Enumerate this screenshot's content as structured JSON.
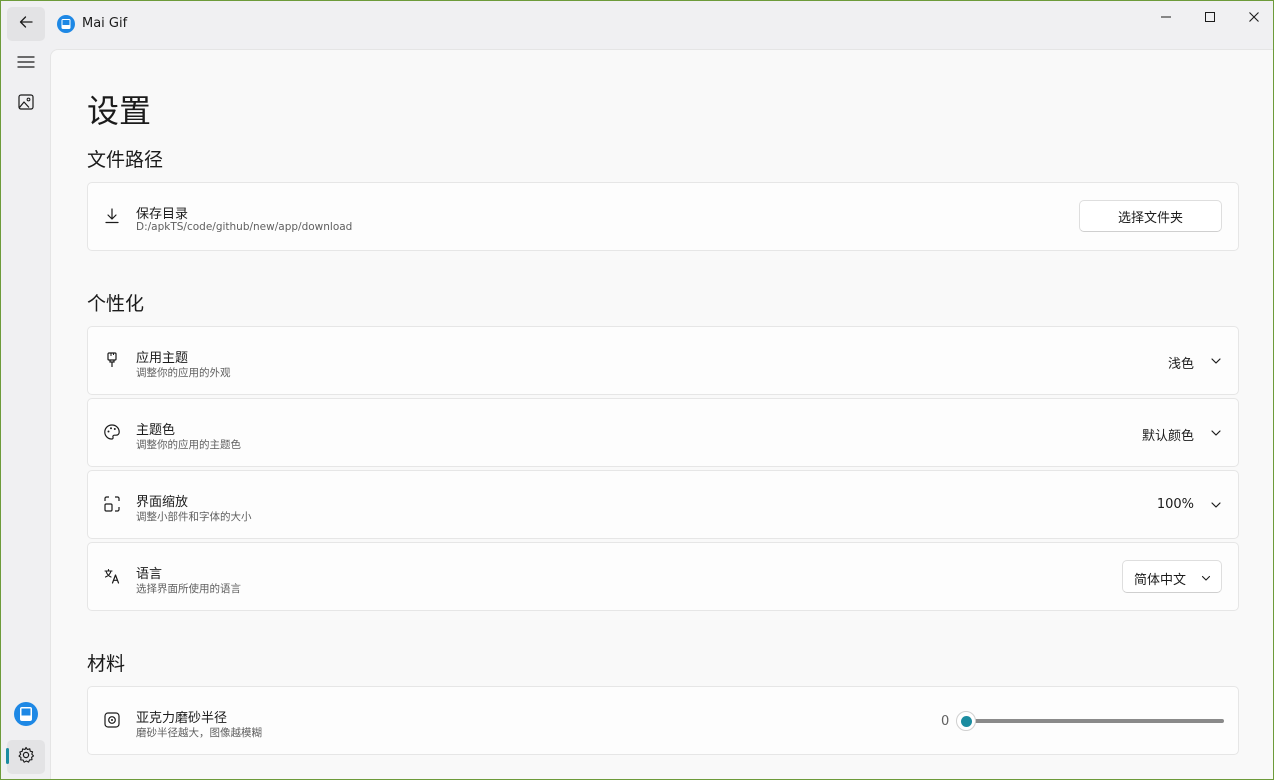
{
  "app": {
    "title": "Mai Gif"
  },
  "page": {
    "title": "设置"
  },
  "colors": {
    "accent": "#1b8ca0",
    "window_border": "#6d9b3a"
  },
  "sections": {
    "file_path": {
      "title": "文件路径",
      "save_dir": {
        "title": "保存目录",
        "subtitle": "D:/apkTS/code/github/new/app/download",
        "button_label": "选择文件夹",
        "icon": "download-icon"
      }
    },
    "personalization": {
      "title": "个性化",
      "theme": {
        "title": "应用主题",
        "subtitle": "调整你的应用的外观",
        "value": "浅色",
        "icon": "brush-icon"
      },
      "accent_color": {
        "title": "主题色",
        "subtitle": "调整你的应用的主题色",
        "value": "默认颜色",
        "icon": "palette-icon"
      },
      "scale": {
        "title": "界面缩放",
        "subtitle": "调整小部件和字体的大小",
        "value": "100%",
        "icon": "scale-icon"
      },
      "language": {
        "title": "语言",
        "subtitle": "选择界面所使用的语言",
        "value": "简体中文",
        "icon": "language-icon"
      }
    },
    "material": {
      "title": "材料",
      "blur_radius": {
        "title": "亚克力磨砂半径",
        "subtitle": "磨砂半径越大，图像越模糊",
        "value": "0",
        "fraction": 0,
        "icon": "target-icon"
      }
    }
  }
}
